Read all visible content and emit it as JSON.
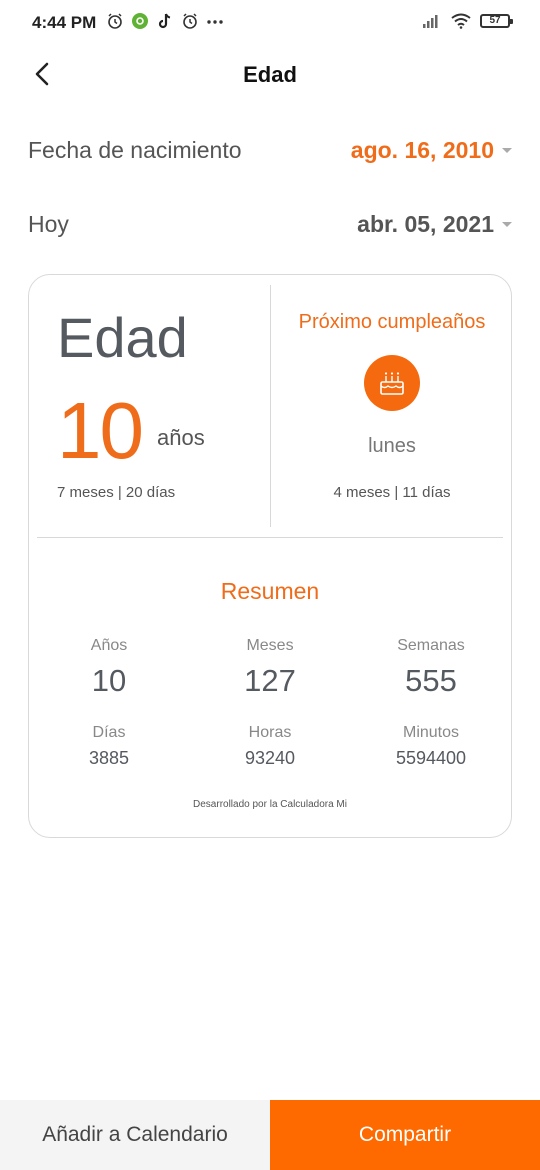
{
  "status_bar": {
    "time": "4:44 PM",
    "battery": "57",
    "icons_left": [
      "alarm-icon",
      "app-icon",
      "tiktok-icon",
      "alarm-icon",
      "more-dots-icon"
    ],
    "icons_right": [
      "signal-icon",
      "wifi-icon",
      "battery-icon"
    ]
  },
  "header": {
    "title": "Edad"
  },
  "birth_date": {
    "label": "Fecha de nacimiento",
    "value": "ago. 16, 2010"
  },
  "today": {
    "label": "Hoy",
    "value": "abr. 05, 2021"
  },
  "age": {
    "heading": "Edad",
    "years": "10",
    "years_unit": "años",
    "detail": "7 meses | 20 días"
  },
  "next_birthday": {
    "title": "Próximo cumpleaños",
    "day": "lunes",
    "detail": "4 meses | 11 días"
  },
  "summary": {
    "title": "Resumen",
    "stats": [
      {
        "label": "Años",
        "value": "10"
      },
      {
        "label": "Meses",
        "value": "127"
      },
      {
        "label": "Semanas",
        "value": "555"
      },
      {
        "label": "Días",
        "value": "3885"
      },
      {
        "label": "Horas",
        "value": "93240"
      },
      {
        "label": "Minutos",
        "value": "5594400"
      }
    ],
    "credit": "Desarrollado por la Calculadora Mi"
  },
  "actions": {
    "calendar_label": "Añadir a Calendario",
    "share_label": "Compartir"
  },
  "colors": {
    "accent": "#ef6c1a",
    "share_button": "#ff6a00"
  }
}
